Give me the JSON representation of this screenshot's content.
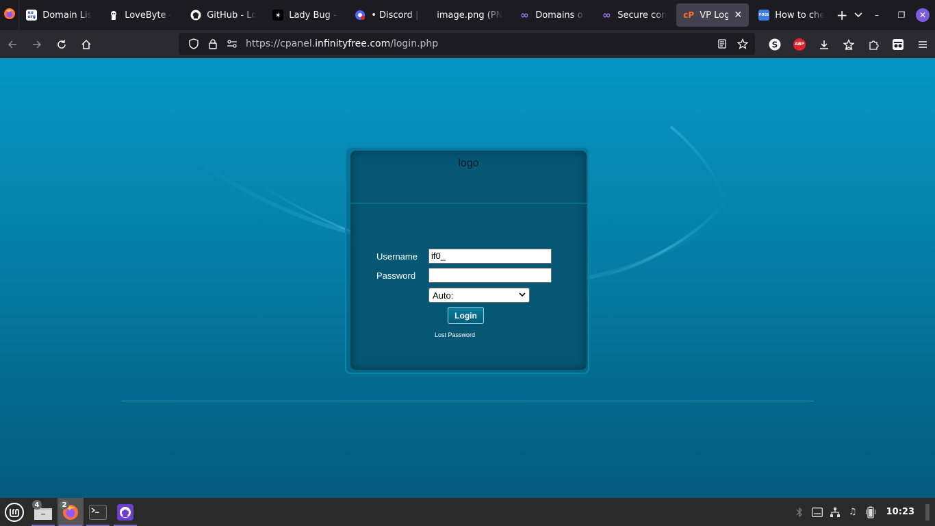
{
  "browser": {
    "tabs": [
      {
        "label": "Domain List",
        "icon": "eu-org-icon",
        "icon_text": "eu org",
        "active": false
      },
      {
        "label": "LoveByte - ",
        "icon": "lovebyte-icon",
        "active": false
      },
      {
        "label": "GitHub - Lo",
        "icon": "github-icon",
        "active": false
      },
      {
        "label": "Lady Bug - F",
        "icon": "ladybug-icon",
        "active": false
      },
      {
        "label": "• Discord | E",
        "icon": "discord-icon",
        "active": false
      },
      {
        "label": "image.png (PN",
        "icon": "",
        "active": false
      },
      {
        "label": "Domains or",
        "icon": "infinity-icon",
        "active": false
      },
      {
        "label": "Secure conn",
        "icon": "infinity-icon",
        "active": false
      },
      {
        "label": "VP Login",
        "icon": "cpanel-icon",
        "icon_text": "cP",
        "active": true
      },
      {
        "label": "How to che",
        "icon": "foss-linux-icon",
        "icon_text": "FOSS",
        "active": false
      }
    ],
    "url": {
      "prefix": "https://cpanel.",
      "host": "infinityfree.com",
      "path": "/login.php"
    }
  },
  "login": {
    "logo_text": "logo",
    "username_label": "Username",
    "username_value": "if0_",
    "password_label": "Password",
    "password_value": "",
    "language_value": "Auto:",
    "login_button": "Login",
    "lost_password": "Lost Password"
  },
  "taskbar": {
    "files_badge": "4",
    "firefox_badge": "2",
    "clock": "10:23"
  },
  "colors": {
    "page_bg_top": "#0696c4",
    "page_bg_bottom": "#045a7c",
    "panel_bg": "#055774",
    "accent": "#7b5ce0"
  }
}
